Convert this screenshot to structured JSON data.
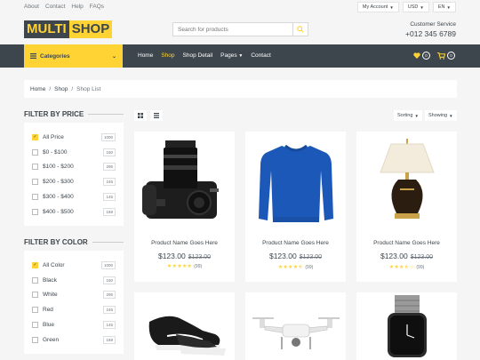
{
  "topbar": {
    "links": [
      "About",
      "Contact",
      "Help",
      "FAQs"
    ],
    "account": "My Account",
    "currency": "USD",
    "language": "EN"
  },
  "logo": {
    "part1": "MULTI",
    "part2": "SHOP"
  },
  "search": {
    "placeholder": "Search for products"
  },
  "customer_service": {
    "title": "Customer Service",
    "phone": "+012 345 6789"
  },
  "nav": {
    "categories": "Categories",
    "links": [
      "Home",
      "Shop",
      "Shop Detail",
      "Pages",
      "Contact"
    ],
    "active": "Shop",
    "wishlist_count": "0",
    "cart_count": "0"
  },
  "breadcrumb": [
    "Home",
    "Shop",
    "Shop List"
  ],
  "filter_price": {
    "title": "FILTER BY PRICE",
    "items": [
      {
        "label": "All Price",
        "count": "1000",
        "checked": true
      },
      {
        "label": "$0 - $100",
        "count": "150",
        "checked": false
      },
      {
        "label": "$100 - $200",
        "count": "295",
        "checked": false
      },
      {
        "label": "$200 - $300",
        "count": "246",
        "checked": false
      },
      {
        "label": "$300 - $400",
        "count": "145",
        "checked": false
      },
      {
        "label": "$400 - $500",
        "count": "168",
        "checked": false
      }
    ]
  },
  "filter_color": {
    "title": "FILTER BY COLOR",
    "items": [
      {
        "label": "All Color",
        "count": "1000",
        "checked": true
      },
      {
        "label": "Black",
        "count": "150",
        "checked": false
      },
      {
        "label": "White",
        "count": "295",
        "checked": false
      },
      {
        "label": "Red",
        "count": "246",
        "checked": false
      },
      {
        "label": "Blue",
        "count": "145",
        "checked": false
      },
      {
        "label": "Green",
        "count": "168",
        "checked": false
      }
    ]
  },
  "toolbar": {
    "sorting": "Sorting",
    "showing": "Showing"
  },
  "products": [
    {
      "name": "Product Name Goes Here",
      "price": "$123.00",
      "old_price": "$123.00",
      "rating": 5,
      "reviews": "(99)",
      "image": "camera-image"
    },
    {
      "name": "Product Name Goes Here",
      "price": "$123.00",
      "old_price": "$123.00",
      "rating": 4.5,
      "reviews": "(99)",
      "image": "sweater-image"
    },
    {
      "name": "Product Name Goes Here",
      "price": "$123.00",
      "old_price": "$123.00",
      "rating": 3.5,
      "reviews": "(99)",
      "image": "lamp-image"
    },
    {
      "name": "",
      "price": "",
      "old_price": "",
      "rating": null,
      "reviews": "",
      "image": "shoes-image"
    },
    {
      "name": "",
      "price": "",
      "old_price": "",
      "rating": null,
      "reviews": "",
      "image": "drone-image"
    },
    {
      "name": "",
      "price": "",
      "old_price": "",
      "rating": null,
      "reviews": "",
      "image": "watch-image"
    }
  ],
  "colors": {
    "accent": "#FFD333",
    "dark": "#3D464D",
    "background": "#F5F5F5"
  }
}
